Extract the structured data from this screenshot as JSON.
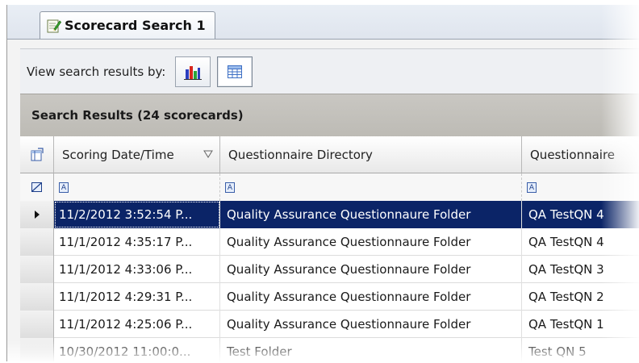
{
  "tab": {
    "title": "Scorecard Search 1"
  },
  "toolbar": {
    "label": "View search results by:",
    "buttons": [
      {
        "icon": "bar-chart-icon",
        "pressed": false
      },
      {
        "icon": "table-grid-icon",
        "pressed": true
      }
    ]
  },
  "results": {
    "title": "Search Results (24 scorecards)"
  },
  "grid": {
    "columns": [
      {
        "label": "Scoring Date/Time",
        "sort": "descending"
      },
      {
        "label": "Questionnaire Directory"
      },
      {
        "label": "Questionnaire"
      }
    ],
    "rows": [
      {
        "date": "11/2/2012  3:52:54  P...",
        "directory": "Quality Assurance Questionnaure Folder",
        "questionnaire": "QA TestQN 4",
        "selected": true
      },
      {
        "date": "11/1/2012  4:35:17  P...",
        "directory": "Quality Assurance Questionnaure Folder",
        "questionnaire": "QA TestQN 4",
        "selected": false
      },
      {
        "date": "11/1/2012  4:33:06  P...",
        "directory": "Quality Assurance Questionnaure Folder",
        "questionnaire": "QA TestQN 3",
        "selected": false
      },
      {
        "date": "11/1/2012  4:29:31  P...",
        "directory": "Quality Assurance Questionnaure Folder",
        "questionnaire": "QA TestQN 2",
        "selected": false
      },
      {
        "date": "11/1/2012  4:25:06  P...",
        "directory": "Quality Assurance Questionnaure Folder",
        "questionnaire": "QA TestQN 1",
        "selected": false
      },
      {
        "date": "10/30/2012  11:00:0...",
        "directory": "Test Folder",
        "questionnaire": "Test QN 5",
        "selected": false
      }
    ]
  },
  "colors": {
    "selection": "#0b2467",
    "results_header": "#c4c2bc"
  }
}
